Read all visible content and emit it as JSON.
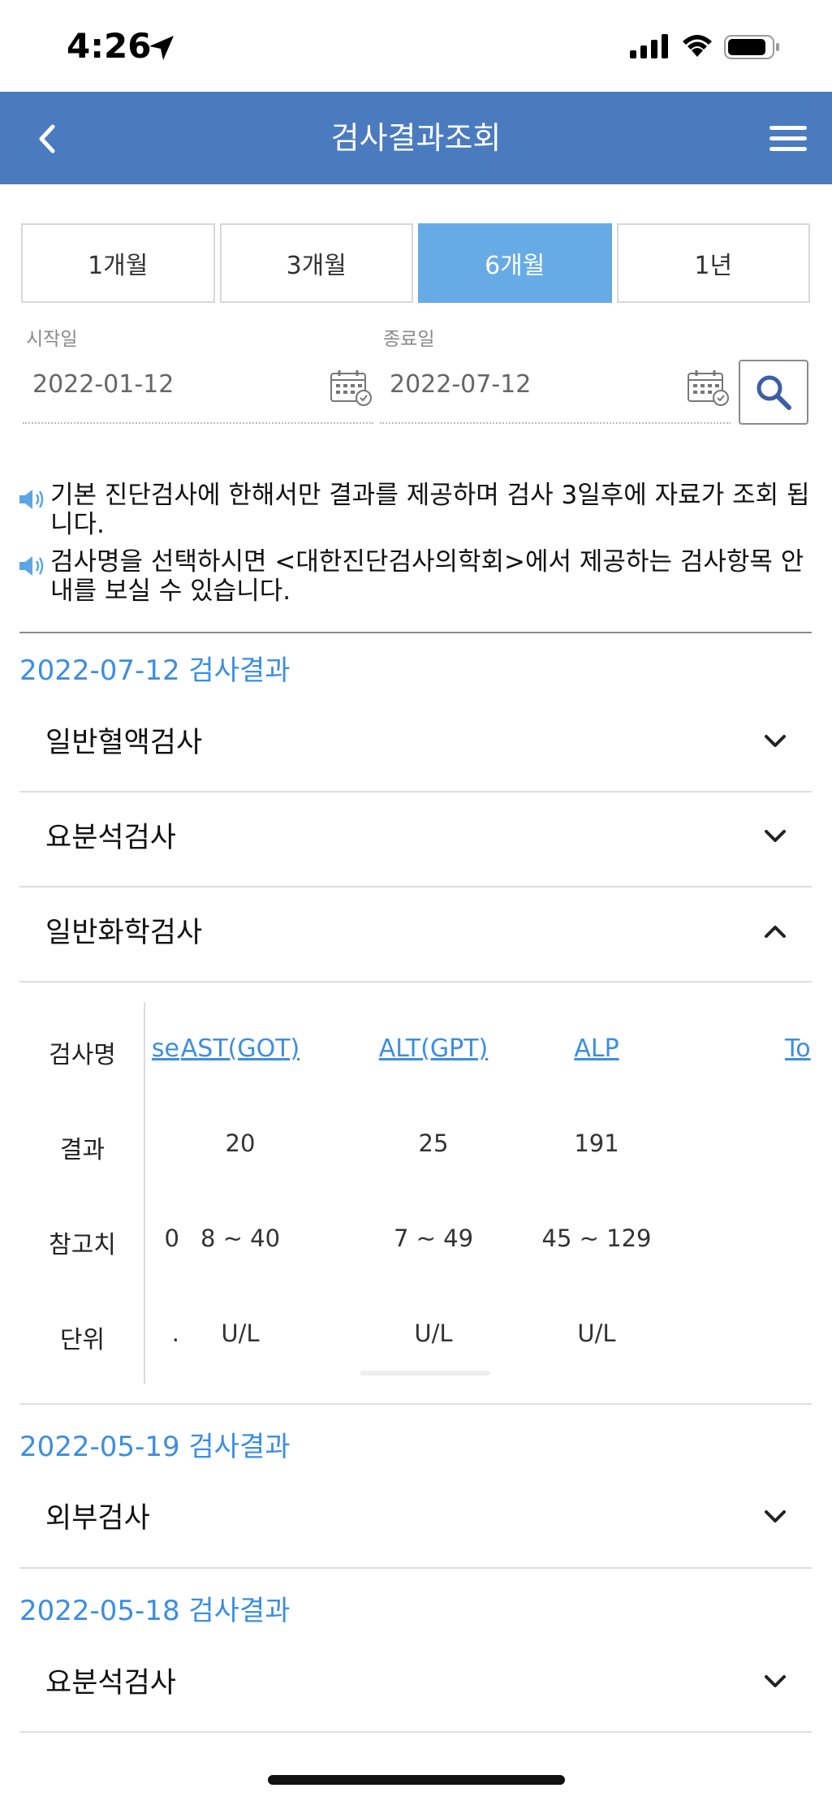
{
  "status_bar": {
    "time": "4:26"
  },
  "header": {
    "title": "검사결과조회"
  },
  "period_tabs": [
    {
      "label": "1개월",
      "active": false
    },
    {
      "label": "3개월",
      "active": false
    },
    {
      "label": "6개월",
      "active": true
    },
    {
      "label": "1년",
      "active": false
    }
  ],
  "date_range": {
    "start_label": "시작일",
    "start_value": "2022-01-12",
    "end_label": "종료일",
    "end_value": "2022-07-12"
  },
  "notices": [
    "기본 진단검사에 한해서만 결과를 제공하며 검사 3일후에 자료가 조회 됩니다.",
    "검사명을 선택하시면 <대한진단검사의학회>에서 제공하는 검사항목 안내를 보실 수 있습니다."
  ],
  "results": [
    {
      "date_title": "2022-07-12 검사결과",
      "groups": [
        {
          "label": "일반혈액검사",
          "expanded": false
        },
        {
          "label": "요분석검사",
          "expanded": false
        },
        {
          "label": "일반화학검사",
          "expanded": true
        }
      ]
    },
    {
      "date_title": "2022-05-19 검사결과",
      "groups": [
        {
          "label": "외부검사",
          "expanded": false
        }
      ]
    },
    {
      "date_title": "2022-05-18 검사결과",
      "groups": [
        {
          "label": "요분석검사",
          "expanded": false
        }
      ]
    }
  ],
  "chem_table": {
    "row_headers": [
      "검사명",
      "결과",
      "참고치",
      "단위"
    ],
    "columns": [
      {
        "name": "se",
        "result": "",
        "ref": "0",
        "unit": "."
      },
      {
        "name": "AST(GOT)",
        "result": "20",
        "ref": "8 ~ 40",
        "unit": "U/L"
      },
      {
        "name": "ALT(GPT)",
        "result": "25",
        "ref": "7 ~ 49",
        "unit": "U/L"
      },
      {
        "name": "ALP",
        "result": "191",
        "ref": "45 ~ 129",
        "unit": "U/L"
      },
      {
        "name": "To",
        "result": "",
        "ref": "",
        "unit": ""
      }
    ]
  },
  "colors": {
    "header_bg": "#4a7bbf",
    "active_tab": "#67abe6",
    "accent_text": "#3d8ee0"
  }
}
